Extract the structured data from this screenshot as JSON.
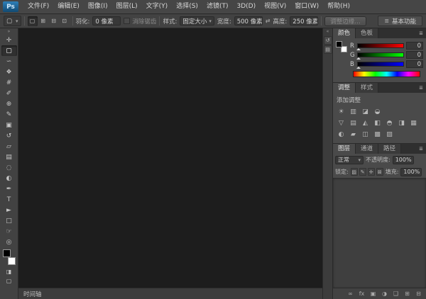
{
  "icons": {
    "panel_menu": "≣",
    "workspace": "≣"
  },
  "colors": {
    "canvas_bg": "#1d1d1d",
    "ui_bg": "#474747",
    "red": "#ff0000",
    "green": "#00ff00",
    "blue": "#0000ff"
  },
  "menubar": {
    "logo": "Ps",
    "items": [
      {
        "label": "文件(F)"
      },
      {
        "label": "编辑(E)"
      },
      {
        "label": "图像(I)"
      },
      {
        "label": "图层(L)"
      },
      {
        "label": "文字(Y)"
      },
      {
        "label": "选择(S)"
      },
      {
        "label": "滤镜(T)"
      },
      {
        "label": "3D(D)"
      },
      {
        "label": "视图(V)"
      },
      {
        "label": "窗口(W)"
      },
      {
        "label": "帮助(H)"
      }
    ]
  },
  "options_bar": {
    "tool_icon": "▢",
    "mode_icons": [
      {
        "name": "new-selection-icon",
        "glyph": "▢",
        "active": true
      },
      {
        "name": "add-to-selection-icon",
        "glyph": "⊞"
      },
      {
        "name": "subtract-from-selection-icon",
        "glyph": "⊟"
      },
      {
        "name": "intersect-selection-icon",
        "glyph": "⊡"
      }
    ],
    "feather_label": "羽化:",
    "feather_value": "0 像素",
    "antialias_label": "消除锯齿",
    "style_label": "样式:",
    "style_value": "固定大小",
    "width_label": "宽度:",
    "width_value": "500 像素",
    "swap_glyph": "⇄",
    "height_label": "高度:",
    "height_value": "250 像素",
    "refine_edge_label": "调整边缘…",
    "workspace_label": "基本功能"
  },
  "toolbar": {
    "grip_glyph": "»",
    "quick_mask_glyph": "◨",
    "screen_mode_glyph": "▢",
    "tools": [
      {
        "name": "move-tool",
        "glyph": "✛"
      },
      {
        "name": "rectangular-marquee-tool",
        "glyph": "▢",
        "active": true
      },
      {
        "name": "lasso-tool",
        "glyph": "∽"
      },
      {
        "name": "quick-selection-tool",
        "glyph": "❖"
      },
      {
        "name": "crop-tool",
        "glyph": "#"
      },
      {
        "name": "eyedropper-tool",
        "glyph": "✐"
      },
      {
        "name": "healing-brush-tool",
        "glyph": "⊕"
      },
      {
        "name": "brush-tool",
        "glyph": "✎"
      },
      {
        "name": "clone-stamp-tool",
        "glyph": "▣"
      },
      {
        "name": "history-brush-tool",
        "glyph": "↺"
      },
      {
        "name": "eraser-tool",
        "glyph": "▱"
      },
      {
        "name": "gradient-tool",
        "glyph": "▤"
      },
      {
        "name": "blur-tool",
        "glyph": "◌"
      },
      {
        "name": "dodge-tool",
        "glyph": "◐"
      },
      {
        "name": "pen-tool",
        "glyph": "✒"
      },
      {
        "name": "type-tool",
        "glyph": "T"
      },
      {
        "name": "path-selection-tool",
        "glyph": "►"
      },
      {
        "name": "shape-tool",
        "glyph": "□"
      },
      {
        "name": "hand-tool",
        "glyph": "☞"
      },
      {
        "name": "zoom-tool",
        "glyph": "◎"
      }
    ]
  },
  "color_panel": {
    "tabs": [
      {
        "label": "颜色",
        "active": true
      },
      {
        "label": "色板"
      }
    ],
    "channels": [
      {
        "label": "R",
        "value": "0",
        "name": "red-channel-ramp"
      },
      {
        "label": "G",
        "value": "0",
        "name": "green-channel-ramp"
      },
      {
        "label": "B",
        "value": "0",
        "name": "blue-channel-ramp"
      }
    ]
  },
  "adjustments_panel": {
    "tabs": [
      {
        "label": "调整",
        "active": true
      },
      {
        "label": "样式"
      }
    ],
    "title": "添加调整",
    "row1": [
      {
        "name": "brightness-contrast-icon",
        "glyph": "☀"
      },
      {
        "name": "levels-icon",
        "glyph": "▥"
      },
      {
        "name": "curves-icon",
        "glyph": "◪"
      },
      {
        "name": "exposure-icon",
        "glyph": "◒"
      }
    ],
    "row2": [
      {
        "name": "vibrance-icon",
        "glyph": "▽"
      },
      {
        "name": "hue-saturation-icon",
        "glyph": "▤"
      },
      {
        "name": "color-balance-icon",
        "glyph": "◭"
      },
      {
        "name": "black-white-icon",
        "glyph": "◧"
      },
      {
        "name": "photo-filter-icon",
        "glyph": "◓"
      },
      {
        "name": "channel-mixer-icon",
        "glyph": "◨"
      },
      {
        "name": "color-lookup-icon",
        "glyph": "▦"
      }
    ],
    "row3": [
      {
        "name": "invert-icon",
        "glyph": "◐"
      },
      {
        "name": "posterize-icon",
        "glyph": "▰"
      },
      {
        "name": "threshold-icon",
        "glyph": "◫"
      },
      {
        "name": "gradient-map-icon",
        "glyph": "▩"
      },
      {
        "name": "selective-color-icon",
        "glyph": "▨"
      }
    ]
  },
  "layers_panel": {
    "tabs": [
      {
        "label": "图层",
        "active": true
      },
      {
        "label": "通道"
      },
      {
        "label": "路径"
      }
    ],
    "blend_mode": "正常",
    "opacity_label": "不透明度:",
    "opacity_value": "100%",
    "lock_label": "锁定:",
    "lock_icons": [
      {
        "name": "lock-transparency-icon",
        "glyph": "▨"
      },
      {
        "name": "lock-pixels-icon",
        "glyph": "✎"
      },
      {
        "name": "lock-position-icon",
        "glyph": "✛"
      },
      {
        "name": "lock-all-icon",
        "glyph": "⊠"
      }
    ],
    "fill_label": "填充:",
    "fill_value": "100%",
    "footer_icons": [
      {
        "name": "link-layers-icon",
        "glyph": "∞"
      },
      {
        "name": "layer-effects-icon",
        "glyph": "fx"
      },
      {
        "name": "add-layer-mask-icon",
        "glyph": "▣"
      },
      {
        "name": "new-adjustment-layer-icon",
        "glyph": "◑"
      },
      {
        "name": "new-group-icon",
        "glyph": "❑"
      },
      {
        "name": "new-layer-icon",
        "glyph": "⊞"
      },
      {
        "name": "delete-layer-icon",
        "glyph": "⊟"
      }
    ]
  },
  "dock_strip": {
    "expand_glyph": "«",
    "icons": [
      {
        "name": "history-panel-icon",
        "glyph": "↺"
      },
      {
        "name": "properties-panel-icon",
        "glyph": "▤"
      }
    ]
  },
  "timeline": {
    "label": "时间轴"
  }
}
